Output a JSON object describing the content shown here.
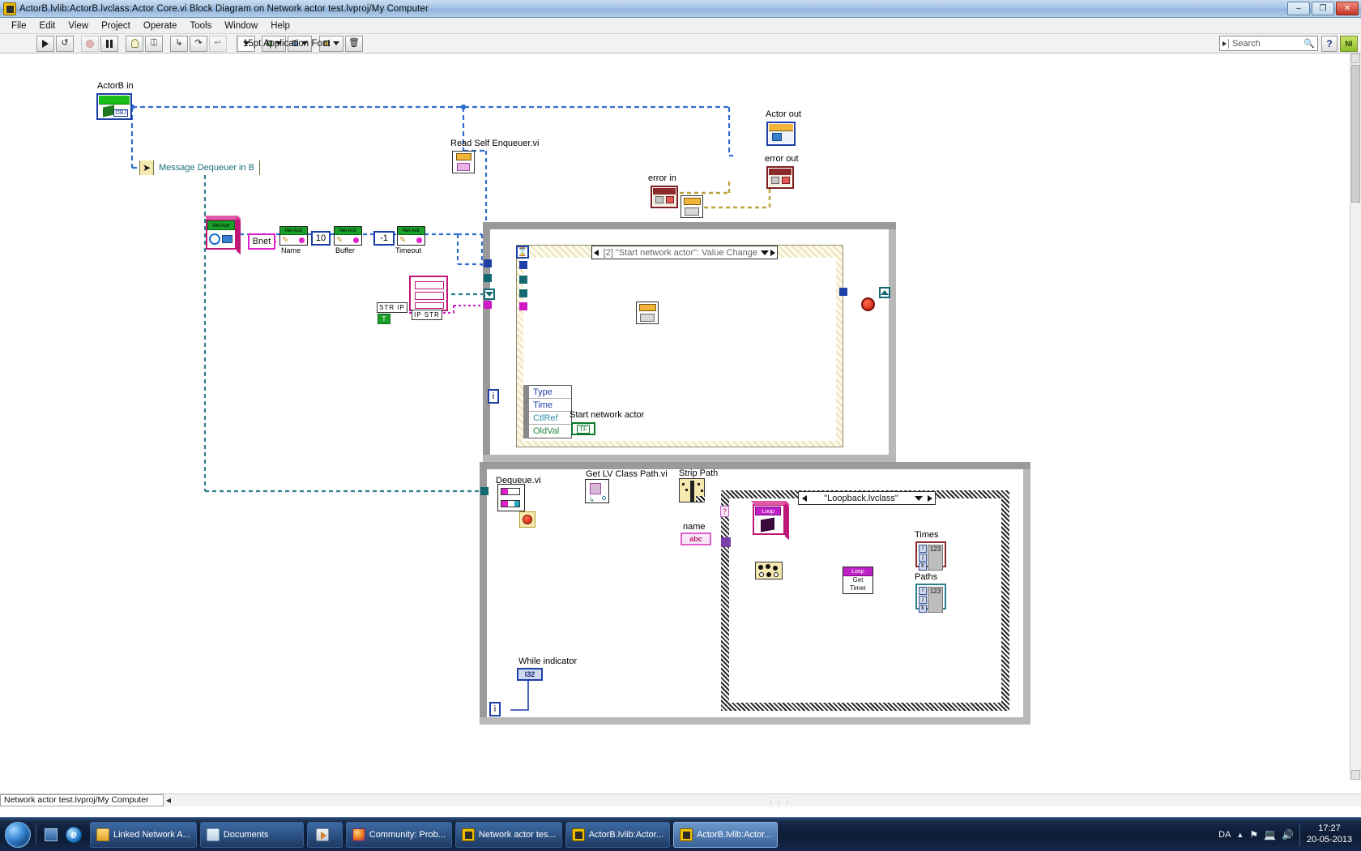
{
  "window": {
    "title": "ActorB.lvlib:ActorB.lvclass:Actor Core.vi Block Diagram on Network actor test.lvproj/My Computer",
    "app_icon": "labview-icon",
    "buttons": [
      {
        "name": "minimize-button",
        "glyph": "–"
      },
      {
        "name": "maximize-button",
        "glyph": "❐"
      },
      {
        "name": "close-button",
        "glyph": "✕"
      }
    ]
  },
  "menubar": {
    "items": [
      "File",
      "Edit",
      "View",
      "Project",
      "Operate",
      "Tools",
      "Window",
      "Help"
    ]
  },
  "toolbar": {
    "run_label": "Run",
    "run_continuous_label": "Run Continuously",
    "abort_label": "Abort Execution",
    "pause_label": "Pause",
    "highlight_label": "Highlight Execution",
    "retain_values_label": "Retain Wire Values",
    "step_into_label": "Step Into",
    "step_over_label": "Step Over",
    "step_out_label": "Step Out",
    "font_selector": "15pt Application Font",
    "align_label": "Align Objects",
    "distribute_label": "Distribute Objects",
    "resize_label": "Resize Objects",
    "reorder_label": "Reorder",
    "cleanup_label": "Clean Up Diagram",
    "search_placeholder": "Search",
    "search_value": "",
    "help_label": "?",
    "ni_label": "NI"
  },
  "statusbar": {
    "context": "Network actor test.lvproj/My Computer",
    "resize_grip": "⋮⋮⋮"
  },
  "diagram": {
    "terminals": {
      "actorb_in": "ActorB in",
      "actor_out": "Actor out",
      "error_in": "error in",
      "error_out": "error out",
      "message_dequeuer_in_b": "Message Dequeuer in B",
      "start_network_actor": "Start network actor",
      "start_network_actor_type": "TF",
      "while_indicator": "While indicator",
      "while_indicator_type": "I32",
      "name": "name",
      "name_type": "abc",
      "times": "Times",
      "paths": "Paths",
      "numeric_type": "123",
      "actorb_in_type": "OBJ"
    },
    "subvis": {
      "read_self_enqueuer": "Read Self Enqueuer.vi",
      "dequeue": "Dequeue.vi",
      "get_lv_class_path": "Get LV Class Path.vi",
      "strip_path": "Strip Path"
    },
    "net_actor_nodes": [
      {
        "label": "Net Actr",
        "sublabel": "Name",
        "input": "Bnet"
      },
      {
        "label": "Net Actr",
        "sublabel": "Buffer",
        "input": "10"
      },
      {
        "label": "Net Actr",
        "sublabel": "Timeout",
        "input": "-1"
      }
    ],
    "net_actor_class_icon": "Net Actr",
    "ip_constants": {
      "str_ip": "STR  IP",
      "ip_str": "IP  STR",
      "t_flag": "T"
    },
    "event_structure": {
      "case_label": "[2] \"Start network actor\": Value Change",
      "timeout_icon": "hourglass-icon",
      "event_data_rows": [
        "Type",
        "Time",
        "CtlRef",
        "OldVal"
      ]
    },
    "case_structure": {
      "case_label": "\"Loopback.lvclass\""
    },
    "loop_class": {
      "constant_label": "Loop",
      "get_timer_top": "Loop",
      "get_timer_line1": "Get",
      "get_timer_line2": "Timer"
    },
    "iteration_terminals": [
      "i",
      "i"
    ]
  },
  "taskbar": {
    "start_label": "Start",
    "quick_launch": [
      {
        "name": "show-desktop-icon",
        "label": ""
      },
      {
        "name": "internet-explorer-icon",
        "label": ""
      }
    ],
    "items": [
      {
        "icon": "folder-icon",
        "label": "Linked Network A...",
        "active": false
      },
      {
        "icon": "document-icon",
        "label": "Documents",
        "active": false
      },
      {
        "icon": "media-player-icon",
        "label": "",
        "active": false
      },
      {
        "icon": "firefox-icon",
        "label": "Community: Prob...",
        "active": false
      },
      {
        "icon": "labview-icon",
        "label": "Network actor tes...",
        "active": false
      },
      {
        "icon": "labview-icon",
        "label": "ActorB.lvlib:Actor...",
        "active": false
      },
      {
        "icon": "labview-icon",
        "label": "ActorB.lvlib:Actor...",
        "active": true
      }
    ],
    "tray": {
      "language": "DA",
      "show_hidden": "▲",
      "network_icon": "network-icon",
      "volume_icon": "volume-icon",
      "action_icon": "flag-icon",
      "time": "17:27",
      "date": "20-05-2013"
    }
  },
  "colors": {
    "accent": "#1c3fa8",
    "wire_object": "#2f6fd0",
    "wire_error": "#b8a33a",
    "wire_queue": "#d018c8",
    "wire_path": "#2f8f8f",
    "wire_numeric": "#8b2b2b",
    "structure": "#9a9a9a",
    "titlebar": "#a8c6e6",
    "taskbar": "#15294a"
  }
}
